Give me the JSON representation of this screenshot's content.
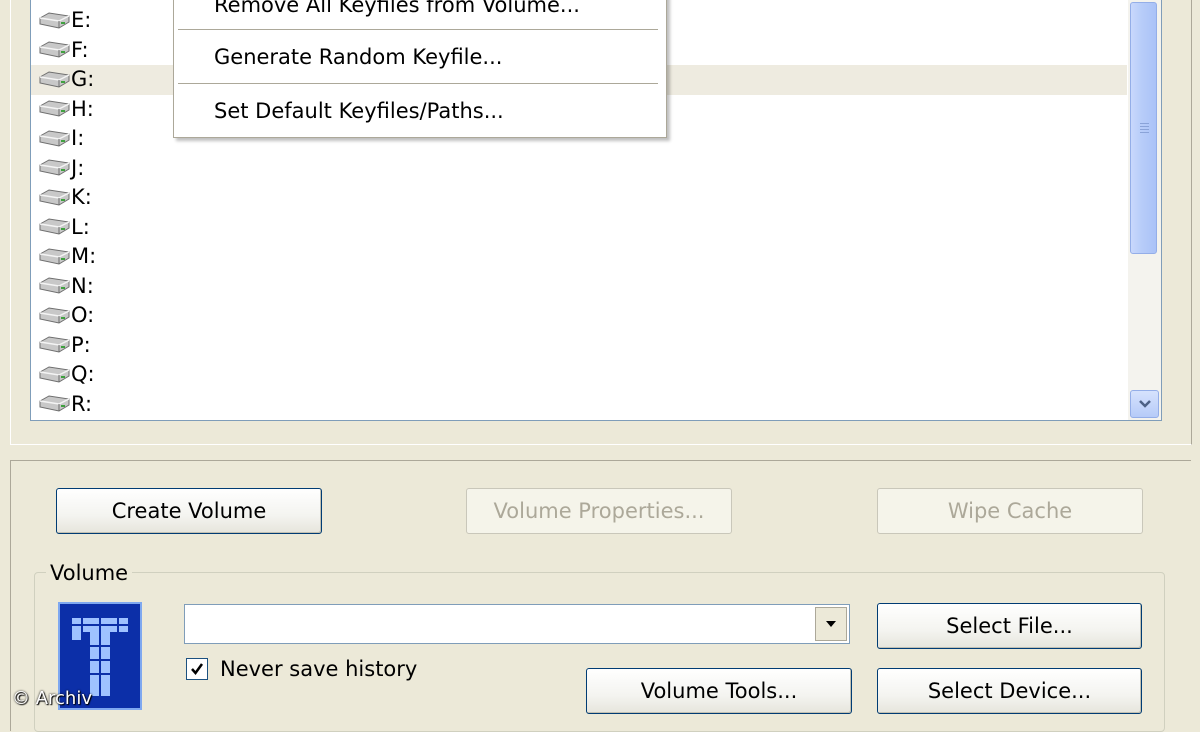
{
  "drives": [
    "E:",
    "F:",
    "G:",
    "H:",
    "I:",
    "J:",
    "K:",
    "L:",
    "M:",
    "N:",
    "O:",
    "P:",
    "Q:",
    "R:"
  ],
  "selected_drive": "G:",
  "context_menu": {
    "items": [
      "Remove All Keyfiles from Volume...",
      "Generate Random Keyfile...",
      "Set Default Keyfiles/Paths..."
    ]
  },
  "buttons": {
    "create_volume": "Create Volume",
    "volume_properties": "Volume Properties...",
    "wipe_cache": "Wipe Cache",
    "select_file": "Select File...",
    "volume_tools": "Volume Tools...",
    "select_device": "Select Device..."
  },
  "volume_group": {
    "label": "Volume",
    "path_value": "",
    "never_save_history_label": "Never save history",
    "never_save_history_checked": true
  },
  "watermark": "© Archiv",
  "colors": {
    "window_bg": "#ece9d8",
    "selected_row": "#eeebe0",
    "scroll_thumb": "#b8cdf9",
    "logo_blue": "#0c2fa8"
  }
}
